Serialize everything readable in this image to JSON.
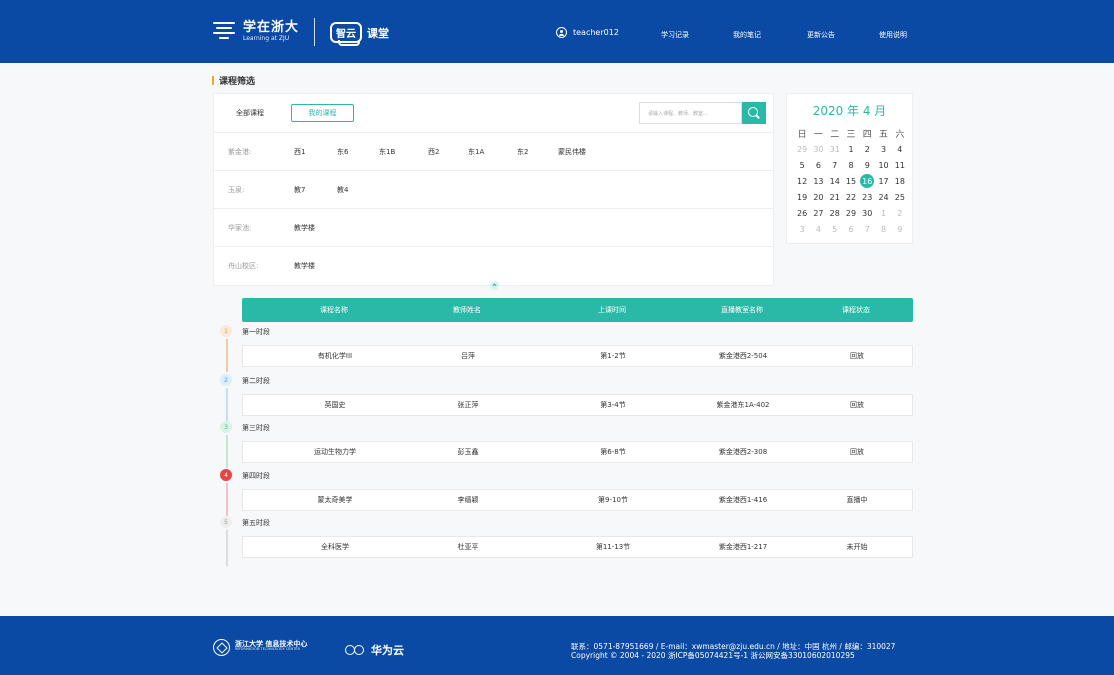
{
  "header": {
    "logo_cn": "学在浙大",
    "logo_en": "Learning at ZJU",
    "zhiyun_badge": "智云",
    "zhiyun_text": "课堂",
    "username": "teacher012",
    "nav": [
      "学习记录",
      "我的笔记",
      "更新公告",
      "使用说明"
    ]
  },
  "section_title": "课程筛选",
  "filter": {
    "tab_all": "全部课程",
    "tab_mine": "我的课程",
    "search_placeholder": "请输入课程、教师、教室...",
    "campuses": [
      {
        "label": "紫金港:",
        "buildings": [
          "西1",
          "东6",
          "东1B",
          "西2",
          "东1A",
          "东2",
          "蒙民伟楼"
        ]
      },
      {
        "label": "玉泉:",
        "buildings": [
          "教7",
          "教4"
        ]
      },
      {
        "label": "华家池:",
        "buildings": [
          "教学楼"
        ]
      },
      {
        "label": "舟山校区:",
        "buildings": [
          "教学楼"
        ]
      }
    ]
  },
  "calendar": {
    "title": "2020 年 4 月",
    "weekdays": [
      "日",
      "一",
      "二",
      "三",
      "四",
      "五",
      "六"
    ],
    "weeks": [
      [
        {
          "d": "29",
          "m": true
        },
        {
          "d": "30",
          "m": true
        },
        {
          "d": "31",
          "m": true
        },
        {
          "d": "1"
        },
        {
          "d": "2"
        },
        {
          "d": "3"
        },
        {
          "d": "4"
        }
      ],
      [
        {
          "d": "5"
        },
        {
          "d": "6"
        },
        {
          "d": "7"
        },
        {
          "d": "8"
        },
        {
          "d": "9"
        },
        {
          "d": "10"
        },
        {
          "d": "11"
        }
      ],
      [
        {
          "d": "12"
        },
        {
          "d": "13"
        },
        {
          "d": "14"
        },
        {
          "d": "15"
        },
        {
          "d": "16",
          "today": true
        },
        {
          "d": "17"
        },
        {
          "d": "18"
        }
      ],
      [
        {
          "d": "19"
        },
        {
          "d": "20"
        },
        {
          "d": "21"
        },
        {
          "d": "22"
        },
        {
          "d": "23"
        },
        {
          "d": "24"
        },
        {
          "d": "25"
        }
      ],
      [
        {
          "d": "26"
        },
        {
          "d": "27"
        },
        {
          "d": "28"
        },
        {
          "d": "29"
        },
        {
          "d": "30"
        },
        {
          "d": "1",
          "m": true
        },
        {
          "d": "2",
          "m": true
        }
      ],
      [
        {
          "d": "3",
          "m": true
        },
        {
          "d": "4",
          "m": true
        },
        {
          "d": "5",
          "m": true
        },
        {
          "d": "6",
          "m": true
        },
        {
          "d": "7",
          "m": true
        },
        {
          "d": "8",
          "m": true
        },
        {
          "d": "9",
          "m": true
        }
      ]
    ]
  },
  "table": {
    "columns": [
      "课程名称",
      "教师姓名",
      "上课时间",
      "直播教室名称",
      "课程状态"
    ],
    "periods": [
      {
        "num": "1",
        "label": "第一时段",
        "color": "#f5c9a6",
        "badge_bg": "#fde9da",
        "badge_fg": "#e69a5f",
        "row": [
          "有机化学III",
          "吕萍",
          "第1-2节",
          "紫金港西2-504",
          "回放"
        ]
      },
      {
        "num": "2",
        "label": "第二时段",
        "color": "#bfe0f5",
        "badge_bg": "#dcefff",
        "badge_fg": "#4aa3df",
        "row": [
          "英国史",
          "张正萍",
          "第3-4节",
          "紫金港东1A-402",
          "回放"
        ]
      },
      {
        "num": "3",
        "label": "第三时段",
        "color": "#bfe9d4",
        "badge_bg": "#d9f3e6",
        "badge_fg": "#3cbf83",
        "row": [
          "运动生物力学",
          "彭玉鑫",
          "第6-8节",
          "紫金港西2-308",
          "回放"
        ]
      },
      {
        "num": "4",
        "label": "第四时段",
        "color": "#f5c0c0",
        "badge_bg": "#e84545",
        "badge_fg": "#ffffff",
        "row": [
          "蒙太奇美学",
          "李缙颖",
          "第9-10节",
          "紫金港西1-416",
          "直播中"
        ]
      },
      {
        "num": "5",
        "label": "第五时段",
        "color": "#dddddd",
        "badge_bg": "#eeeeee",
        "badge_fg": "#999999",
        "row": [
          "全科医学",
          "杜亚平",
          "第11-13节",
          "紫金港西1-217",
          "未开始"
        ]
      }
    ]
  },
  "footer": {
    "zju_cn": "浙江大学 信息技术中心",
    "zju_en": "INFORMATION TECHNOLOGY CENTER",
    "huawei": "华为云",
    "contact": "联系：0571-87951669 / E-mail：xwmaster@zju.edu.cn / 地址：中国 杭州 / 邮编：310027",
    "copyright": "Copyright © 2004 - 2020 浙ICP备05074421号-1 浙公网安备33010602010295"
  }
}
